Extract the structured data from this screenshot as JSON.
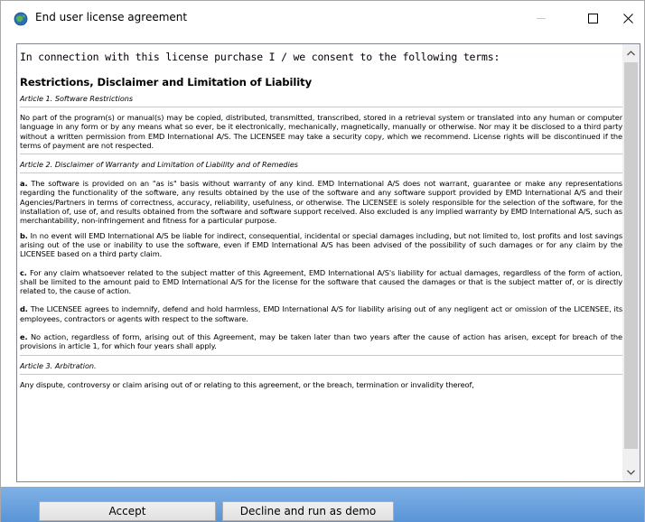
{
  "window": {
    "title": "End user license agreement",
    "icons": {
      "app": "globe-icon",
      "minimize": "minimize-icon",
      "maximize": "maximize-icon",
      "close": "close-icon"
    }
  },
  "license": {
    "intro": "In connection with this license purchase I / we consent to the following terms:",
    "heading": "Restrictions, Disclaimer and Limitation of Liability",
    "article1_title": "Article 1.  Software Restrictions",
    "article1_text": "No part of the program(s) or manual(s) may be copied, distributed, transmitted, transcribed, stored in a retrieval system or translated into any human or computer language in any form or by any means what so ever, be it electronically, mechanically, magnetically, manually or otherwise. Nor may it be disclosed to a third party without a written permission from EMD International A/S. The LICENSEE may take a security copy, which we recommend. License rights will be discontinued if the terms of payment are not respected.",
    "article2_title": "Article 2.  Disclaimer of Warranty and Limitation of Liability and of Remedies",
    "clauses": [
      {
        "letter": "a.",
        "text": "The software is provided on an \"as is\" basis without warranty of any kind. EMD International A/S does not warrant, guarantee or make any representations regarding the functionality of the software, any results obtained by the use of the software and any software support provided by EMD International A/S and their Agencies/Partners in terms of correctness, accuracy, reliability, usefulness, or otherwise. The LICENSEE is solely responsible for the selection of the software, for the installation of, use of, and results obtained from the software and software support received.  Also excluded is any implied warranty by EMD International A/S, such as merchantability, non-infringement and fitness for a particular purpose."
      },
      {
        "letter": "b.",
        "text": "In no event will EMD International A/S be liable for indirect, consequential, incidental or special damages including, but not limited to, lost profits and lost savings arising out of the use or inability to use the software, even if EMD International A/S has been advised of the possibility of such damages or for any claim by the LICENSEE based on a third party claim."
      },
      {
        "letter": "c.",
        "text": "For any claim whatsoever related to the subject matter of this Agreement, EMD International A/S's liability for actual damages, regardless of the form of action, shall be limited to the amount paid to EMD International A/S for the license for the software that caused the damages or that is the subject matter of, or is directly related to, the cause of action."
      },
      {
        "letter": "d.",
        "text": "The LICENSEE agrees to indemnify, defend and hold harmless, EMD International A/S for liability arising out of any negligent act or omission of the LICENSEE, its employees, contractors or agents with respect to the software."
      },
      {
        "letter": "e.",
        "text": "No action, regardless of form, arising out of this Agreement, may be taken later than two years after the cause of action has arisen, except for breach of the provisions in article 1, for which four years shall apply."
      }
    ],
    "article3_title": "Article 3. Arbitration.",
    "article3_text": "Any dispute, controversy or claim arising out of or relating to this agreement, or the breach, termination or invalidity thereof,"
  },
  "scrollbar": {
    "up_icon": "scroll-up-arrow-icon",
    "down_icon": "scroll-down-arrow-icon"
  },
  "buttons": {
    "accept": "Accept",
    "decline": "Decline and run as demo"
  },
  "colors": {
    "bottom_bar": "#6aa3dd",
    "thumb": "#cdcdcd"
  }
}
